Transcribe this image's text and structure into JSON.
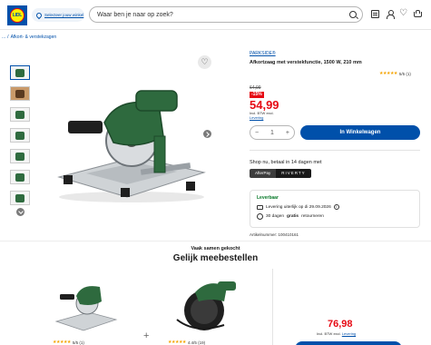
{
  "header": {
    "logo_text": "LIDL",
    "store_selector": "Selecteer jouw winkel",
    "search_placeholder": "Waar ben je naar op zoek?"
  },
  "breadcrumb": [
    "...",
    "/",
    "Afkort- & verstekzagen"
  ],
  "product": {
    "brand": "PARKSIDE®",
    "title": "Afkortzaag met verstekfunctie, 1500 W, 210 mm",
    "rating_stars": "★★★★★",
    "rating_text": "5/5 (1)",
    "old_price": "64,99",
    "discount": "-15%",
    "price": "54,99",
    "price_note_line1": "Incl. BTW excl.",
    "price_note_link": "Levering",
    "quantity": "1",
    "qty_minus": "−",
    "qty_plus": "+",
    "add_to_cart": "In Winkelwagen",
    "shop_now": "Shop nu, betaal in 14 dagen met",
    "pay_options": [
      "AfterPay",
      "RIVERTY"
    ],
    "availability_title": "Leverbaar",
    "delivery_text": "Levering uiterlijk op di 29.09.2026",
    "return_prefix": "30 dagen",
    "return_bold": "gratis",
    "return_suffix": "retourneren",
    "article_number": "Artikelnummer: 100410161"
  },
  "bundle": {
    "subtitle": "Vaak samen gekocht",
    "title": "Gelijk meebestellen",
    "item1_rating": "5/5 (1)",
    "item2_rating": "4.4/5 (19)",
    "stars": "★★★★★",
    "plus": "+",
    "total_price": "76,98",
    "price_note": "Incl. BTW excl.",
    "price_note_link": "Levering"
  }
}
